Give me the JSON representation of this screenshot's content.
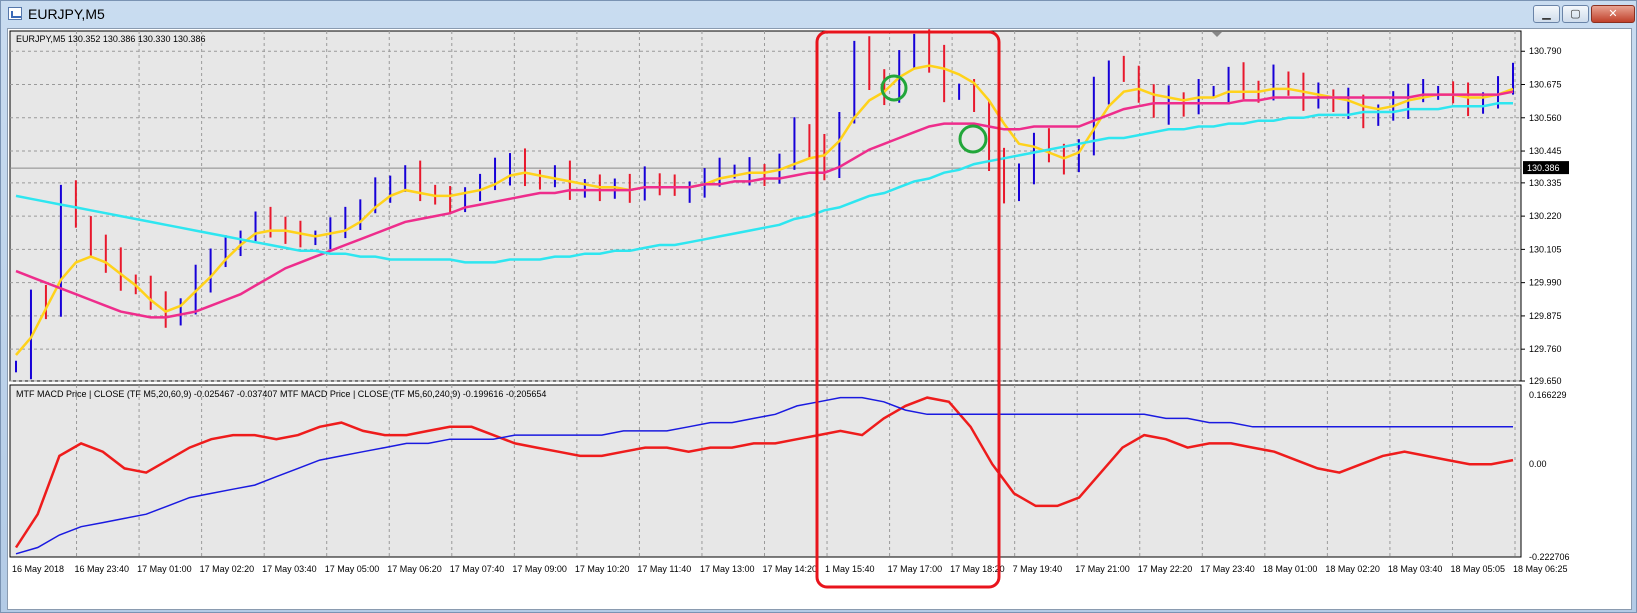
{
  "window": {
    "title": "EURJPY,M5",
    "buttons": {
      "minimize": "▁",
      "maximize": "▢",
      "close": "✕"
    }
  },
  "chart_data": [
    {
      "type": "line",
      "title": "EURJPY,M5  130.352 130.386 130.330 130.386",
      "x": [
        "16 May 2018",
        "16 May 23:40",
        "17 May 01:00",
        "17 May 02:20",
        "17 May 03:40",
        "17 May 05:00",
        "17 May 06:20",
        "17 May 07:40",
        "17 May 09:00",
        "17 May 10:20",
        "17 May 11:40",
        "17 May 13:00",
        "17 May 14:20",
        "17 May 15:40",
        "17 May 17:00",
        "17 May 18:20",
        "17 May 19:40",
        "17 May 21:00",
        "17 May 22:20",
        "17 May 23:40",
        "18 May 01:00",
        "18 May 02:20",
        "18 May 03:40",
        "18 May 05:05",
        "18 May 06:25"
      ],
      "x_tick_labels": [
        "16 May 2018",
        "16 May 23:40",
        "17 May 01:00",
        "17 May 02:20",
        "17 May 03:40",
        "17 May 05:00",
        "17 May 06:20",
        "17 May 07:40",
        "17 May 09:00",
        "17 May 10:20",
        "17 May 11:40",
        "17 May 13:00",
        "17 May 14:20",
        "17 May 15:40",
        "17 May 17:00",
        "17 May 18:20",
        "17 May 19:40",
        "17 May 21:00",
        "17 May 22:20",
        "17 May 23:40",
        "18 May 01:00",
        "18 May 02:20",
        "18 May 03:40",
        "18 May 05:05",
        "18 May 06:25"
      ],
      "x_tick_labels_display": [
        "16 May 2018",
        "16 May 23:40",
        "17 May 01:00",
        "17 May 02:20",
        "17 May 03:40",
        "17 May 05:00",
        "17 May 06:20",
        "17 May 07:40",
        "17 May 09:00",
        "17 May 10:20",
        "17 May 11:40",
        "17 May 13:00",
        "17 May 14:20",
        "1 May 15:40",
        "17 May 17:00",
        "17 May 18:20",
        "7 May 19:40",
        "17 May 21:00",
        "17 May 22:20",
        "17 May 23:40",
        "18 May 01:00",
        "18 May 02:20",
        "18 May 03:40",
        "18 May 05:05",
        "18 May 06:25"
      ],
      "y_ticks": [
        130.79,
        130.675,
        130.56,
        130.445,
        130.335,
        130.22,
        130.105,
        129.99,
        129.875,
        129.76,
        129.65
      ],
      "y_tick_labels": [
        "130.790",
        "130.675",
        "130.560",
        "130.445",
        "130.335",
        "130.220",
        "130.105",
        "129.990",
        "129.875",
        "129.760",
        "129.650"
      ],
      "ylim": [
        129.65,
        130.86
      ],
      "current_price": "130.386",
      "current_price_value": 130.386,
      "close": [
        129.7,
        129.93,
        129.9,
        130.3,
        130.2,
        130.12,
        130.06,
        129.99,
        129.97,
        129.94,
        129.87,
        129.9,
        130.0,
        130.08,
        130.11,
        130.15,
        130.2,
        130.19,
        130.16,
        130.14,
        130.15,
        130.18,
        130.2,
        130.25,
        130.31,
        130.34,
        130.36,
        130.3,
        130.28,
        130.27,
        130.3,
        130.33,
        130.37,
        130.41,
        130.36,
        130.34,
        130.36,
        130.32,
        130.32,
        130.3,
        130.33,
        130.31,
        130.34,
        130.32,
        130.31,
        130.32,
        130.35,
        130.37,
        130.37,
        130.38,
        130.36,
        130.4,
        130.51,
        130.46,
        130.38,
        130.56,
        130.79,
        130.7,
        130.64,
        130.75,
        130.83,
        130.76,
        130.65,
        130.65,
        130.6,
        130.42,
        130.3,
        130.35,
        130.48,
        130.45,
        130.4,
        130.45,
        130.65,
        130.73,
        130.72,
        130.64,
        130.58,
        130.62,
        130.6,
        130.65,
        130.65,
        130.7,
        130.66,
        130.64,
        130.7,
        130.68,
        130.62,
        130.63,
        130.6,
        130.62,
        130.56,
        130.57,
        130.6,
        130.65,
        130.65,
        130.65,
        130.63,
        130.61,
        130.62,
        130.66,
        130.73
      ],
      "series": [
        {
          "name": "",
          "color": "#1600d8",
          "style": "bars",
          "values": "close"
        },
        {
          "name": "",
          "color": "#ffd21a",
          "values": [
            129.74,
            129.8,
            129.9,
            130.0,
            130.06,
            130.08,
            130.06,
            130.02,
            129.98,
            129.93,
            129.89,
            129.91,
            129.96,
            130.01,
            130.07,
            130.12,
            130.16,
            130.17,
            130.17,
            130.16,
            130.15,
            130.16,
            130.17,
            130.2,
            130.25,
            130.29,
            130.31,
            130.3,
            130.29,
            130.29,
            130.3,
            130.31,
            130.33,
            130.36,
            130.37,
            130.36,
            130.35,
            130.34,
            130.33,
            130.32,
            130.32,
            130.31,
            130.32,
            130.32,
            130.32,
            130.32,
            130.33,
            130.35,
            130.36,
            130.37,
            130.37,
            130.38,
            130.4,
            130.42,
            130.43,
            130.48,
            130.56,
            130.62,
            130.65,
            130.7,
            130.73,
            130.74,
            130.73,
            130.71,
            130.68,
            130.62,
            130.54,
            130.47,
            130.46,
            130.44,
            130.42,
            130.44,
            130.52,
            130.6,
            130.65,
            130.66,
            130.64,
            130.63,
            130.62,
            130.63,
            130.63,
            130.65,
            130.65,
            130.65,
            130.66,
            130.66,
            130.65,
            130.64,
            130.63,
            130.62,
            130.6,
            130.59,
            130.6,
            130.62,
            130.63,
            130.64,
            130.64,
            130.63,
            130.63,
            130.64,
            130.66
          ]
        },
        {
          "name": "",
          "color": "#ee2d8c",
          "values": [
            130.03,
            130.01,
            129.99,
            129.97,
            129.95,
            129.93,
            129.91,
            129.89,
            129.88,
            129.87,
            129.87,
            129.88,
            129.89,
            129.91,
            129.93,
            129.95,
            129.98,
            130.01,
            130.04,
            130.06,
            130.08,
            130.1,
            130.12,
            130.14,
            130.16,
            130.18,
            130.2,
            130.21,
            130.22,
            130.23,
            130.25,
            130.26,
            130.27,
            130.28,
            130.29,
            130.3,
            130.3,
            130.31,
            130.31,
            130.31,
            130.31,
            130.31,
            130.32,
            130.32,
            130.32,
            130.32,
            130.33,
            130.33,
            130.34,
            130.34,
            130.35,
            130.35,
            130.36,
            130.37,
            130.37,
            130.39,
            130.42,
            130.45,
            130.47,
            130.49,
            130.51,
            130.53,
            130.54,
            130.54,
            130.54,
            130.53,
            130.52,
            130.52,
            130.53,
            130.53,
            130.53,
            130.53,
            130.55,
            130.57,
            130.59,
            130.6,
            130.61,
            130.61,
            130.61,
            130.61,
            130.61,
            130.61,
            130.62,
            130.62,
            130.63,
            130.63,
            130.63,
            130.63,
            130.63,
            130.63,
            130.63,
            130.63,
            130.63,
            130.63,
            130.64,
            130.64,
            130.64,
            130.64,
            130.64,
            130.64,
            130.65
          ]
        },
        {
          "name": "",
          "color": "#2ee6f0",
          "values": [
            130.29,
            130.28,
            130.27,
            130.26,
            130.25,
            130.24,
            130.23,
            130.22,
            130.21,
            130.2,
            130.19,
            130.18,
            130.17,
            130.16,
            130.15,
            130.14,
            130.13,
            130.12,
            130.11,
            130.1,
            130.1,
            130.09,
            130.09,
            130.08,
            130.08,
            130.07,
            130.07,
            130.07,
            130.07,
            130.07,
            130.06,
            130.06,
            130.06,
            130.07,
            130.07,
            130.07,
            130.08,
            130.08,
            130.09,
            130.09,
            130.1,
            130.1,
            130.11,
            130.12,
            130.12,
            130.13,
            130.14,
            130.15,
            130.16,
            130.17,
            130.18,
            130.19,
            130.21,
            130.22,
            130.24,
            130.25,
            130.27,
            130.29,
            130.3,
            130.32,
            130.34,
            130.35,
            130.37,
            130.38,
            130.4,
            130.41,
            130.42,
            130.43,
            130.44,
            130.45,
            130.46,
            130.47,
            130.48,
            130.49,
            130.49,
            130.5,
            130.51,
            130.52,
            130.52,
            130.53,
            130.53,
            130.54,
            130.54,
            130.55,
            130.55,
            130.56,
            130.56,
            130.57,
            130.57,
            130.57,
            130.58,
            130.58,
            130.58,
            130.59,
            130.59,
            130.59,
            130.6,
            130.6,
            130.6,
            130.61,
            130.61
          ]
        }
      ],
      "grid": true,
      "annotations": [
        "red-rectangle-highlight",
        "green-circle-1",
        "green-circle-2"
      ]
    },
    {
      "type": "line",
      "title": "MTF MACD Price | CLOSE  (TF M5,20,60,9) -0.025467 -0.037407  MTF MACD Price | CLOSE  (TF M5,60,240,9) -0.199616 -0.205654",
      "y_ticks": [
        0.166229,
        0.0,
        -0.222706
      ],
      "y_tick_labels": [
        "0.166229",
        "0.00",
        "-0.222706"
      ],
      "ylim": [
        -0.222706,
        0.166229
      ],
      "series": [
        {
          "name": "",
          "color": "#ee1c1c",
          "values": [
            -0.2,
            -0.12,
            0.02,
            0.05,
            0.03,
            -0.01,
            -0.02,
            0.01,
            0.04,
            0.06,
            0.07,
            0.07,
            0.06,
            0.07,
            0.09,
            0.1,
            0.08,
            0.07,
            0.07,
            0.08,
            0.09,
            0.09,
            0.07,
            0.05,
            0.04,
            0.03,
            0.02,
            0.02,
            0.03,
            0.04,
            0.04,
            0.03,
            0.04,
            0.04,
            0.05,
            0.05,
            0.06,
            0.07,
            0.08,
            0.07,
            0.11,
            0.14,
            0.16,
            0.15,
            0.09,
            0.0,
            -0.07,
            -0.1,
            -0.1,
            -0.08,
            -0.02,
            0.04,
            0.07,
            0.06,
            0.04,
            0.05,
            0.05,
            0.04,
            0.03,
            0.01,
            -0.01,
            -0.02,
            0.0,
            0.02,
            0.03,
            0.02,
            0.01,
            0.0,
            0.0,
            0.01
          ]
        },
        {
          "name": "",
          "color": "#1a1ae0",
          "values": [
            -0.215,
            -0.2,
            -0.17,
            -0.15,
            -0.14,
            -0.13,
            -0.12,
            -0.1,
            -0.08,
            -0.07,
            -0.06,
            -0.05,
            -0.03,
            -0.01,
            0.01,
            0.02,
            0.03,
            0.04,
            0.05,
            0.05,
            0.06,
            0.06,
            0.06,
            0.07,
            0.07,
            0.07,
            0.07,
            0.07,
            0.08,
            0.08,
            0.08,
            0.09,
            0.1,
            0.1,
            0.11,
            0.12,
            0.14,
            0.15,
            0.16,
            0.16,
            0.15,
            0.13,
            0.12,
            0.12,
            0.12,
            0.12,
            0.12,
            0.12,
            0.12,
            0.12,
            0.12,
            0.12,
            0.12,
            0.11,
            0.11,
            0.1,
            0.1,
            0.09,
            0.09,
            0.09,
            0.09,
            0.09,
            0.09,
            0.09,
            0.09,
            0.09,
            0.09,
            0.09,
            0.09,
            0.09
          ]
        }
      ],
      "grid": true
    }
  ]
}
